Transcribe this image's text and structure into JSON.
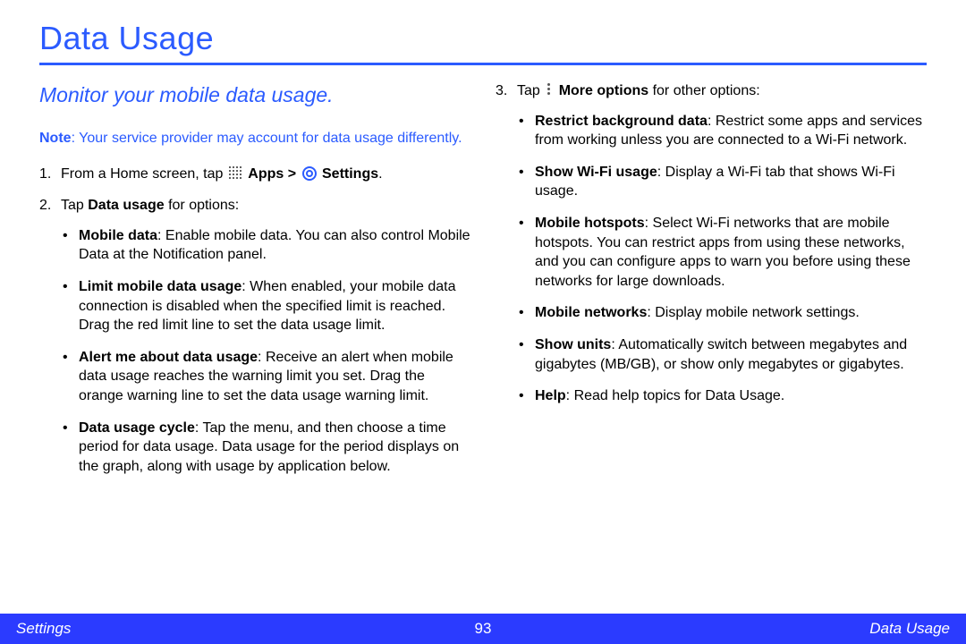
{
  "title": "Data Usage",
  "subtitle": "Monitor your mobile data usage.",
  "note": {
    "label": "Note",
    "text": ": Your service provider may account for data usage differently."
  },
  "steps": {
    "s1": {
      "num": "1.",
      "pre": "From a Home screen, tap ",
      "apps": "Apps",
      "gt": " > ",
      "settings": "Settings",
      "post": "."
    },
    "s2": {
      "num": "2.",
      "pre": "Tap ",
      "bold": "Data usage",
      "post": " for options:",
      "items": [
        {
          "bold": "Mobile data",
          "text": ": Enable mobile data. You can also control Mobile Data at the Notification panel."
        },
        {
          "bold": "Limit mobile data usage",
          "text": ": When enabled, your mobile data connection is disabled when the specified limit is reached. Drag the red limit line to set the data usage limit."
        },
        {
          "bold": "Alert me about data usage",
          "text": ": Receive an alert when mobile data usage reaches the warning limit you set. Drag the orange warning line to set the data usage warning limit."
        },
        {
          "bold": "Data usage cycle",
          "text": ": Tap the menu, and then choose a time period for data usage. Data usage for the period displays on the graph, along with usage by application below."
        }
      ]
    },
    "s3": {
      "num": "3.",
      "pre": "Tap ",
      "bold": "More options",
      "post": " for other options:",
      "items": [
        {
          "bold": "Restrict background data",
          "text": ": Restrict some apps and services from working unless you are connected to a Wi-Fi network."
        },
        {
          "bold": "Show Wi-Fi usage",
          "text": ": Display a Wi-Fi tab that shows Wi-Fi usage."
        },
        {
          "bold": "Mobile hotspots",
          "text": ": Select Wi-Fi networks that are mobile hotspots. You can restrict apps from using these networks, and you can configure apps to warn you before using these networks for large downloads."
        },
        {
          "bold": "Mobile networks",
          "text": ": Display mobile network settings."
        },
        {
          "bold": "Show units",
          "text": ": Automatically switch between megabytes and gigabytes (MB/GB), or show only megabytes or gigabytes."
        },
        {
          "bold": "Help",
          "text": ": Read help topics for Data Usage."
        }
      ]
    }
  },
  "footer": {
    "left": "Settings",
    "center": "93",
    "right": "Data Usage"
  }
}
